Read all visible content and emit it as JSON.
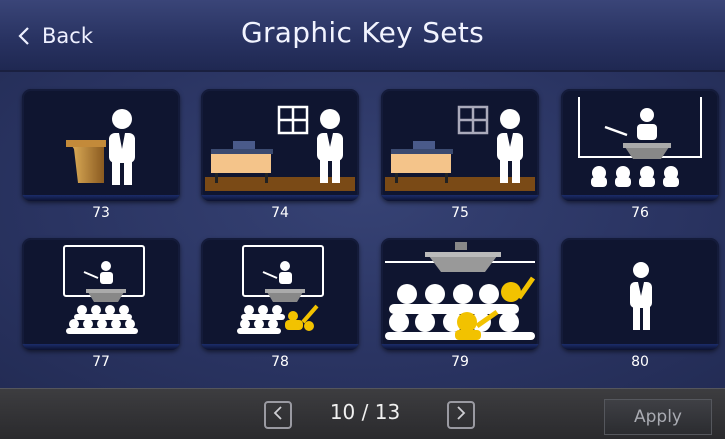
{
  "header": {
    "back_label": "Back",
    "title": "Graphic Key Sets"
  },
  "tiles": [
    {
      "label": "73",
      "icon": "presenter-podium-icon"
    },
    {
      "label": "74",
      "icon": "presenter-desk-window-icon"
    },
    {
      "label": "75",
      "icon": "presenter-desk-window-icon"
    },
    {
      "label": "76",
      "icon": "lecturer-audience-icon"
    },
    {
      "label": "77",
      "icon": "screen-lecture-audience-icon"
    },
    {
      "label": "78",
      "icon": "screen-lecture-raised-hand-icon"
    },
    {
      "label": "79",
      "icon": "audience-raised-hands-icon"
    },
    {
      "label": "80",
      "icon": "standing-person-icon"
    }
  ],
  "footer": {
    "page_indicator": "10 / 13",
    "apply_label": "Apply"
  },
  "colors": {
    "header_bg": "#293362",
    "grid_bg": "#2a3462",
    "tile_bg": "#0f1530",
    "accent_yellow": "#f2c200",
    "floor_brown": "#7a4a16"
  }
}
